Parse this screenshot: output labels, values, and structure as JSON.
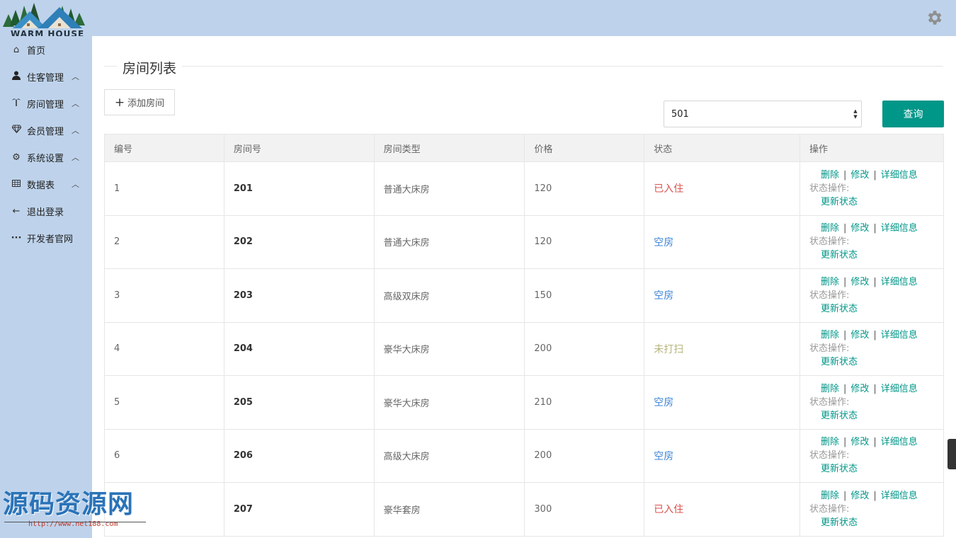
{
  "app": {
    "logo_text": "WARM HOUSE"
  },
  "sidebar": {
    "items": [
      {
        "label": "首页",
        "icon": "home-icon"
      },
      {
        "label": "住客管理",
        "icon": "user-icon",
        "caret": true
      },
      {
        "label": "房间管理",
        "icon": "palm-icon",
        "caret": true
      },
      {
        "label": "会员管理",
        "icon": "diamond-icon",
        "caret": true
      },
      {
        "label": "系统设置",
        "icon": "gear-icon",
        "caret": true
      },
      {
        "label": "数据表",
        "icon": "table-icon",
        "caret": true
      },
      {
        "label": "退出登录",
        "icon": "arrow-left-icon"
      },
      {
        "label": "开发者官网",
        "icon": "ellipsis-icon"
      }
    ]
  },
  "page": {
    "title": "房间列表"
  },
  "toolbar": {
    "add_label": "添加房间",
    "search_value": "501",
    "query_label": "查询"
  },
  "table": {
    "columns": [
      "编号",
      "房间号",
      "房间类型",
      "价格",
      "状态",
      "操作"
    ],
    "rows": [
      {
        "id": "1",
        "room": "201",
        "type": "普通大床房",
        "price": "120",
        "status": "已入住",
        "status_kind": "occupied"
      },
      {
        "id": "2",
        "room": "202",
        "type": "普通大床房",
        "price": "120",
        "status": "空房",
        "status_kind": "empty"
      },
      {
        "id": "3",
        "room": "203",
        "type": "高级双床房",
        "price": "150",
        "status": "空房",
        "status_kind": "empty"
      },
      {
        "id": "4",
        "room": "204",
        "type": "豪华大床房",
        "price": "200",
        "status": "未打扫",
        "status_kind": "dirty"
      },
      {
        "id": "5",
        "room": "205",
        "type": "豪华大床房",
        "price": "210",
        "status": "空房",
        "status_kind": "empty"
      },
      {
        "id": "6",
        "room": "206",
        "type": "高级大床房",
        "price": "200",
        "status": "空房",
        "status_kind": "empty"
      },
      {
        "id": "",
        "room": "207",
        "type": "豪华套房",
        "price": "300",
        "status": "已入住",
        "status_kind": "occupied"
      }
    ],
    "ops": {
      "delete": "删除",
      "edit": "修改",
      "detail": "详细信息",
      "status_label": "状态操作:",
      "update": "更新状态",
      "sep": "|"
    }
  },
  "watermark": {
    "main": "源码资源网",
    "url": "http://www.net188.com"
  },
  "colors": {
    "header_bg": "#bed3eb",
    "accent": "#009688",
    "occupied": "#d9534f",
    "empty": "#3e85d6",
    "dirty": "#b6b77f"
  }
}
